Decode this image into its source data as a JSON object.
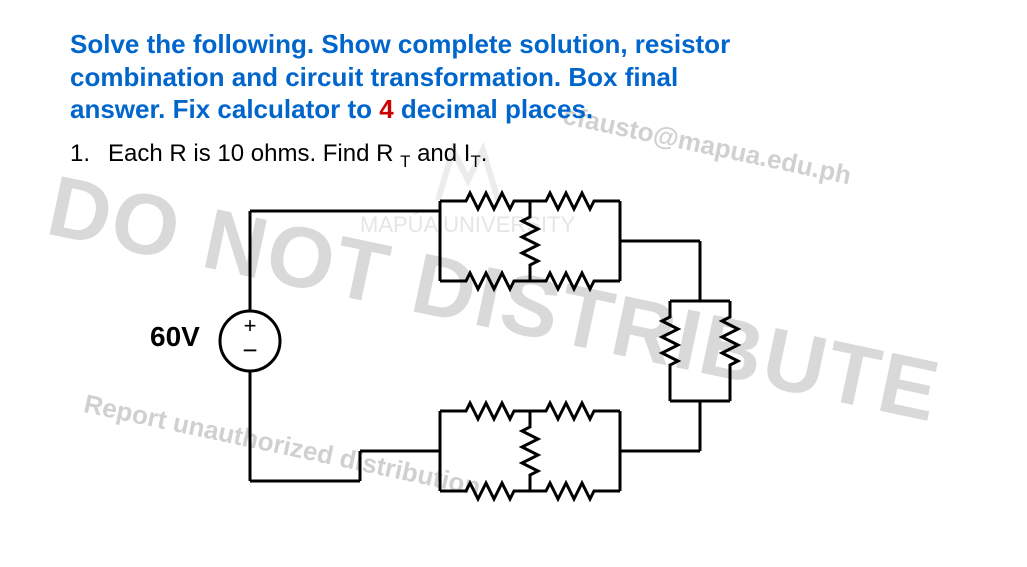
{
  "instruction": {
    "line1": "Solve the following. Show complete solution, resistor",
    "line2": "combination and circuit transformation. Box final",
    "line3_a": "answer. Fix calculator to ",
    "line3_red": "4",
    "line3_b": " decimal places."
  },
  "question": {
    "number": "1.",
    "text_a": "Each R is 10 ohms. Find R ",
    "sub1": "T",
    "text_b": " and I",
    "sub2": "T",
    "text_c": "."
  },
  "source": {
    "voltage": "60V",
    "polarity_top": "+",
    "polarity_bottom": "−"
  },
  "watermarks": {
    "big": "DO NOT DISTRIBUTE",
    "email": "cfausto@mapua.edu.ph",
    "report": "Report unauthorized distribution",
    "logo_hint": "MAPÚA UNIVERSITY"
  }
}
